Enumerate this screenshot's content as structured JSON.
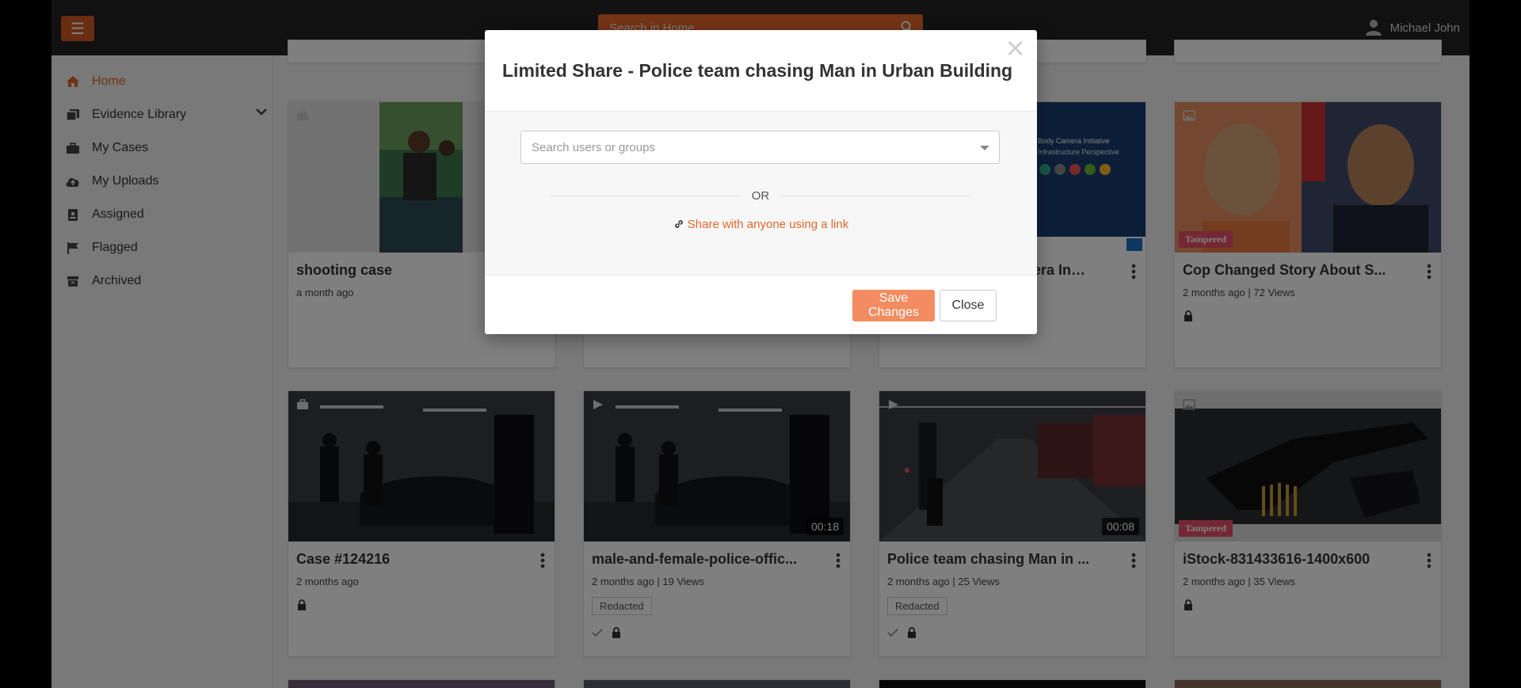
{
  "header": {
    "search_placeholder": "Search in Home",
    "user_name": "Michael John",
    "menu_icon": "hamburger-icon",
    "search_icon": "search-icon",
    "user_icon": "user-icon",
    "accent_color": "#e0662b"
  },
  "sidebar": {
    "items": [
      {
        "label": "Home",
        "icon": "home-icon",
        "active": true
      },
      {
        "label": "Evidence Library",
        "icon": "library-icon",
        "expandable": true
      },
      {
        "label": "My Cases",
        "icon": "briefcase-icon"
      },
      {
        "label": "My Uploads",
        "icon": "cloud-upload-icon"
      },
      {
        "label": "Assigned",
        "icon": "assigned-icon"
      },
      {
        "label": "Flagged",
        "icon": "flag-icon"
      },
      {
        "label": "Archived",
        "icon": "archive-icon"
      }
    ]
  },
  "cards": [
    {
      "title": "shooting case",
      "meta": "a month ago",
      "type": "case"
    },
    {
      "title": "",
      "meta": "",
      "type": "hidden"
    },
    {
      "title": "…amera In…",
      "meta": "",
      "type": "image",
      "thumb_text": [
        "Body Camera Initiative",
        "Infrastructure Perspective"
      ]
    },
    {
      "title": "Cop Changed Story About S...",
      "meta": "2 months ago  |  72 Views",
      "type": "image",
      "badge": "Tampered",
      "locked": true
    },
    {
      "title": "Case #124216",
      "meta": "2 months ago",
      "type": "case",
      "locked": true
    },
    {
      "title": "male-and-female-police-offic...",
      "meta": "2 months ago  |  19 Views",
      "type": "video",
      "duration": "00:18",
      "tag": "Redacted",
      "checked": true,
      "locked": true
    },
    {
      "title": "Police team chasing Man in ...",
      "meta": "2 months ago  |  25 Views",
      "type": "video",
      "duration": "00:08",
      "tag": "Redacted",
      "checked": true,
      "locked": true
    },
    {
      "title": "iStock-831433616-1400x600",
      "meta": "2 months ago  |  35 Views",
      "type": "image",
      "badge": "Tampered",
      "locked": true
    }
  ],
  "modal": {
    "title": "Limited Share - Police team chasing Man in Urban Building",
    "close_glyph": "×",
    "search_placeholder": "Search users or groups",
    "or_text": "OR",
    "share_link_text": "Share with anyone using a link",
    "save_label": "Save Changes",
    "close_label": "Close",
    "save_color": "#f38c60"
  }
}
